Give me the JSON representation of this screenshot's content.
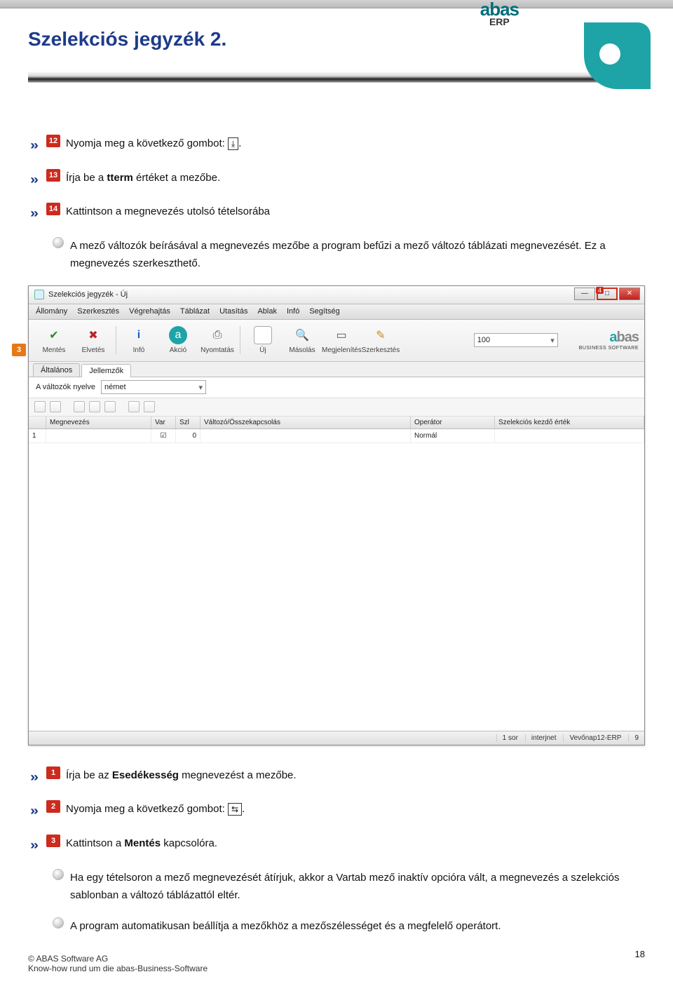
{
  "logo": {
    "top_name": "abas",
    "top_sub": "ERP"
  },
  "page_title": "Szelekciós jegyzék 2.",
  "steps_upper": [
    {
      "num": "12",
      "text_pre": "Nyomja meg a következő gombot: ",
      "glyph": "⤓",
      "text_post": "."
    },
    {
      "num": "13",
      "text": "Írja be a ",
      "bold": "tterm",
      "text2": " értéket a mezőbe."
    },
    {
      "num": "14",
      "text": "Kattintson a megnevezés utolsó tételsorába"
    }
  ],
  "tip_upper": "A mező változók beírásával a megnevezés mezőbe a program befűzi a mező változó táblázati megnevezését. Ez a megnevezés szerkeszthető.",
  "app": {
    "side_marker": "3",
    "win_title": "Szelekciós jegyzék - Új",
    "win_close_tag": "4",
    "menubar": [
      "Állomány",
      "Szerkesztés",
      "Végrehajtás",
      "Táblázat",
      "Utasítás",
      "Ablak",
      "Infó",
      "Segítség"
    ],
    "toolbar": [
      {
        "label": "Mentés",
        "icon": "save",
        "glyph": "✔"
      },
      {
        "label": "Elvetés",
        "icon": "discard",
        "glyph": "✖"
      },
      {
        "label": "Infó",
        "icon": "info",
        "glyph": "i"
      },
      {
        "label": "Akció",
        "icon": "act",
        "glyph": "a"
      },
      {
        "label": "Nyomtatás",
        "icon": "print",
        "glyph": "⎙"
      },
      {
        "label": "Új",
        "icon": "new",
        "glyph": ""
      },
      {
        "label": "Másolás",
        "icon": "search",
        "glyph": "🔍"
      },
      {
        "label": "Megjelenítés",
        "icon": "view",
        "glyph": "▭"
      },
      {
        "label": "Szerkesztés",
        "icon": "edit",
        "glyph": "✎"
      }
    ],
    "combo_value": "100",
    "brand": "abas",
    "brand_sub": "BUSINESS SOFTWARE",
    "tabs": [
      "Általános",
      "Jellemzők"
    ],
    "form_label": "A változók nyelve",
    "form_value": "német",
    "grid_headers": [
      "",
      "Megnevezés",
      "Var",
      "Szl",
      "Változó/Összekapcsolás",
      "Operátor",
      "Szelekciós kezdő érték"
    ],
    "grid_widths": [
      25,
      150,
      35,
      35,
      300,
      120,
      200
    ],
    "grid_row": {
      "idx": "1",
      "szl": "0",
      "cb": "☑",
      "op": "Normál"
    },
    "statusbar": [
      "1 sor",
      "interjnet",
      "Vevőnap12-ERP",
      "9"
    ]
  },
  "steps_lower": [
    {
      "num": "1",
      "text": "Írja be az ",
      "bold": "Esedékesség",
      "text2": " megnevezést a mezőbe."
    },
    {
      "num": "2",
      "text_pre": "Nyomja meg a következő gombot: ",
      "glyph": "⇆",
      "text_post": "."
    },
    {
      "num": "3",
      "text": "Kattintson a ",
      "bold": "Mentés",
      "text2": " kapcsolóra."
    }
  ],
  "tip_lower1": "Ha egy tételsoron a mező megnevezését átírjuk, akkor a Vartab mező inaktív opcióra vált, a megnevezés a szelekciós sablonban a változó táblázattól eltér.",
  "tip_lower2": "A program automatikusan beállítja a mezőkhöz a mezőszélességet és a megfelelő operátort.",
  "footer_line1": "© ABAS Software AG",
  "footer_line2": "Know-how rund um die abas-Business-Software",
  "page_number": "18"
}
